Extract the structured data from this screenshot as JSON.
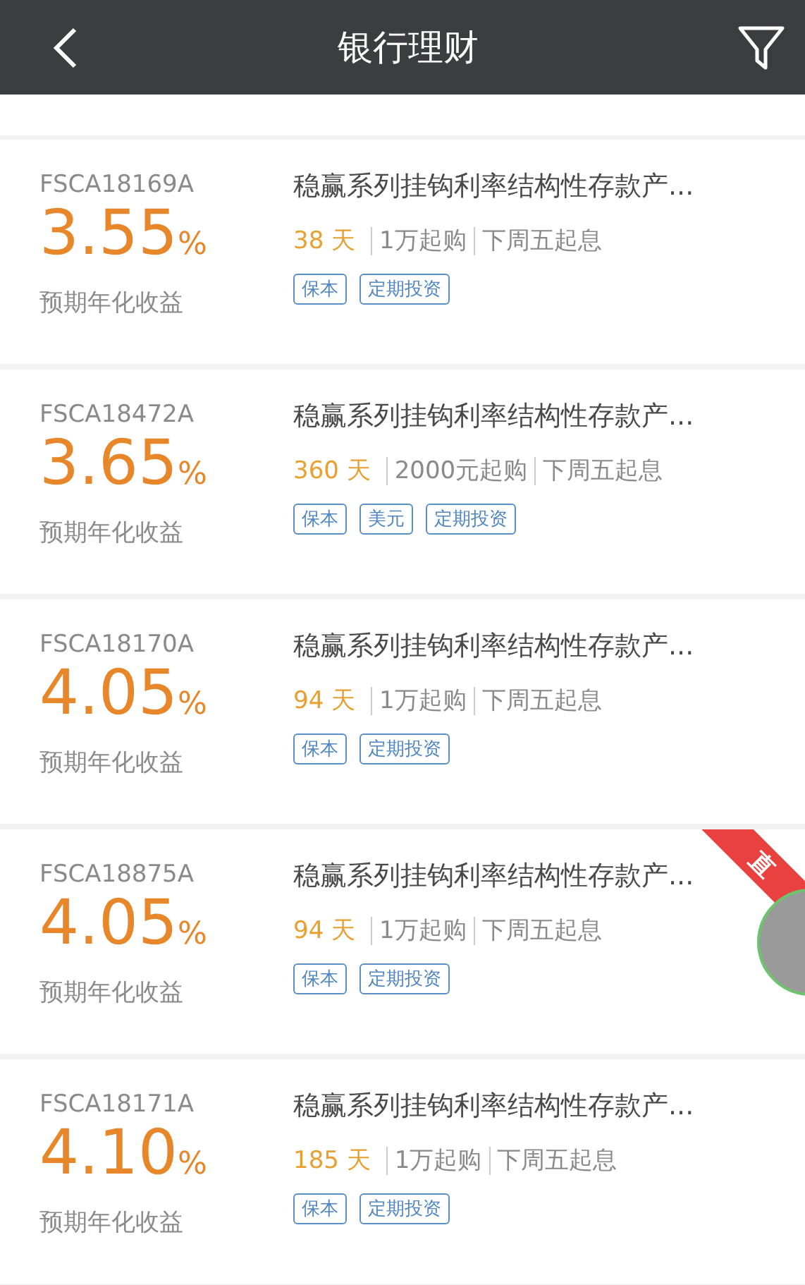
{
  "header": {
    "title": "银行理财"
  },
  "products": [
    {
      "code": "FSCA18169A",
      "rate": "3.55",
      "unit": "%",
      "rate_label": "预期年化收益",
      "title": "稳赢系列挂钩利率结构性存款产...",
      "term": "38 天",
      "min_buy": "1万起购",
      "start": "下周五起息",
      "tags": [
        "保本",
        "定期投资"
      ]
    },
    {
      "code": "FSCA18472A",
      "rate": "3.65",
      "unit": "%",
      "rate_label": "预期年化收益",
      "title": "稳赢系列挂钩利率结构性存款产...",
      "term": "360 天",
      "min_buy": "2000元起购",
      "start": "下周五起息",
      "tags": [
        "保本",
        "美元",
        "定期投资"
      ]
    },
    {
      "code": "FSCA18170A",
      "rate": "4.05",
      "unit": "%",
      "rate_label": "预期年化收益",
      "title": "稳赢系列挂钩利率结构性存款产...",
      "term": "94 天",
      "min_buy": "1万起购",
      "start": "下周五起息",
      "tags": [
        "保本",
        "定期投资"
      ]
    },
    {
      "code": "FSCA18875A",
      "rate": "4.05",
      "unit": "%",
      "rate_label": "预期年化收益",
      "title": "稳赢系列挂钩利率结构性存款产...",
      "term": "94 天",
      "min_buy": "1万起购",
      "start": "下周五起息",
      "tags": [
        "保本",
        "定期投资"
      ],
      "live_ribbon": "直"
    },
    {
      "code": "FSCA18171A",
      "rate": "4.10",
      "unit": "%",
      "rate_label": "预期年化收益",
      "title": "稳赢系列挂钩利率结构性存款产...",
      "term": "185 天",
      "min_buy": "1万起购",
      "start": "下周五起息",
      "tags": [
        "保本",
        "定期投资"
      ]
    }
  ]
}
